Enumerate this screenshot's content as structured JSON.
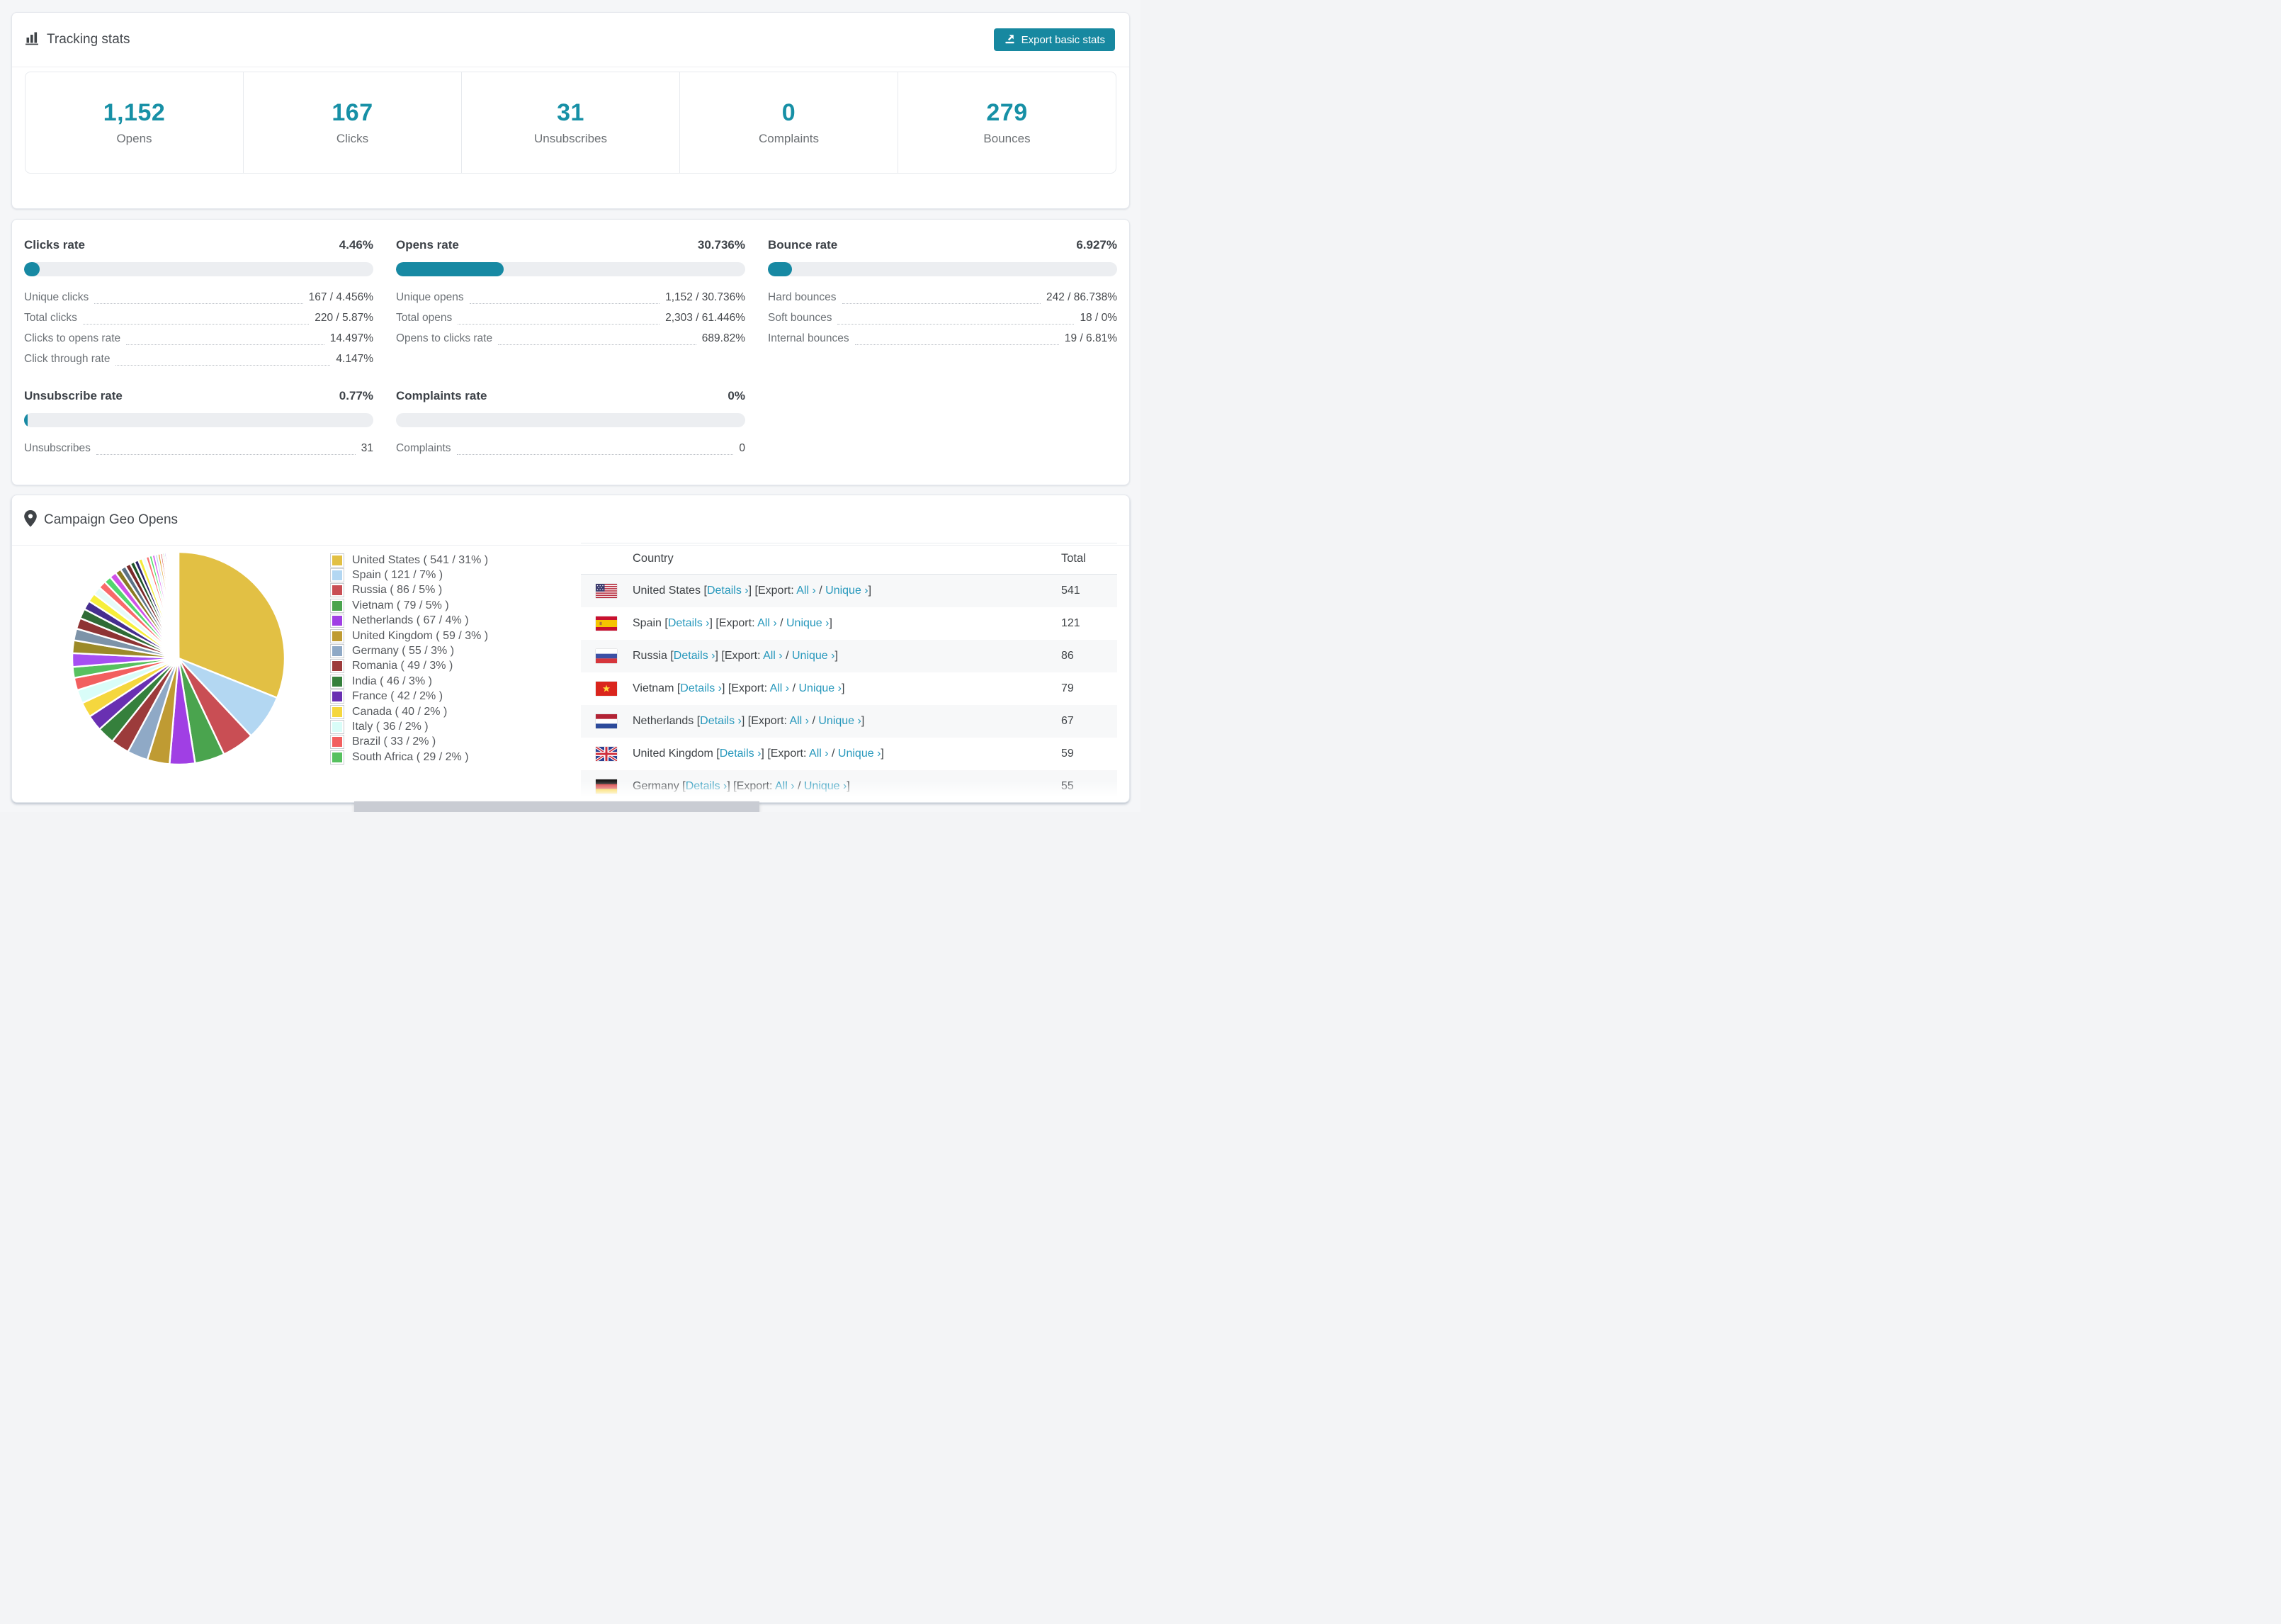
{
  "tracking_card": {
    "title": "Tracking stats",
    "export_button": {
      "label": "Export basic stats"
    },
    "stats": [
      {
        "value": "1,152",
        "label": "Opens"
      },
      {
        "value": "167",
        "label": "Clicks"
      },
      {
        "value": "31",
        "label": "Unsubscribes"
      },
      {
        "value": "0",
        "label": "Complaints"
      },
      {
        "value": "279",
        "label": "Bounces"
      }
    ]
  },
  "rates_card": {
    "sections": [
      {
        "title": "Clicks rate",
        "value": "4.46%",
        "percent": 4.46,
        "rows": [
          {
            "label": "Unique clicks",
            "value": "167 / 4.456%"
          },
          {
            "label": "Total clicks",
            "value": "220 / 5.87%"
          },
          {
            "label": "Clicks to opens rate",
            "value": "14.497%"
          },
          {
            "label": "Click through rate",
            "value": "4.147%"
          }
        ]
      },
      {
        "title": "Opens rate",
        "value": "30.736%",
        "percent": 30.736,
        "rows": [
          {
            "label": "Unique opens",
            "value": "1,152 / 30.736%"
          },
          {
            "label": "Total opens",
            "value": "2,303 / 61.446%"
          },
          {
            "label": "Opens to clicks rate",
            "value": "689.82%"
          }
        ]
      },
      {
        "title": "Bounce rate",
        "value": "6.927%",
        "percent": 6.927,
        "rows": [
          {
            "label": "Hard bounces",
            "value": "242 / 86.738%"
          },
          {
            "label": "Soft bounces",
            "value": "18 / 0%"
          },
          {
            "label": "Internal bounces",
            "value": "19 / 6.81%"
          }
        ]
      },
      {
        "title": "Unsubscribe rate",
        "value": "0.77%",
        "percent": 0.77,
        "rows": [
          {
            "label": "Unsubscribes",
            "value": "31"
          }
        ]
      },
      {
        "title": "Complaints rate",
        "value": "0%",
        "percent": 0,
        "rows": [
          {
            "label": "Complaints",
            "value": "0"
          }
        ]
      }
    ]
  },
  "geo_card": {
    "title": "Campaign Geo Opens",
    "chart_data": {
      "type": "pie",
      "title": "Campaign Geo Opens",
      "legend_position": "right",
      "series": [
        {
          "name": "United States",
          "count": 541,
          "pct": "31%",
          "color": "#e2c044",
          "flag": "us"
        },
        {
          "name": "Spain",
          "count": 121,
          "pct": "7%",
          "color": "#b3d7f2",
          "flag": "es"
        },
        {
          "name": "Russia",
          "count": 86,
          "pct": "5%",
          "color": "#c94e54",
          "flag": "ru"
        },
        {
          "name": "Vietnam",
          "count": 79,
          "pct": "5%",
          "color": "#4aa44e",
          "flag": "vn"
        },
        {
          "name": "Netherlands",
          "count": 67,
          "pct": "4%",
          "color": "#a03fe4",
          "flag": "nl"
        },
        {
          "name": "United Kingdom",
          "count": 59,
          "pct": "3%",
          "color": "#bf9b33",
          "flag": "gb"
        },
        {
          "name": "Germany",
          "count": 55,
          "pct": "3%",
          "color": "#8fa9c6",
          "flag": "de"
        },
        {
          "name": "Romania",
          "count": 49,
          "pct": "3%",
          "color": "#9c3b3b"
        },
        {
          "name": "India",
          "count": 46,
          "pct": "3%",
          "color": "#35803c"
        },
        {
          "name": "France",
          "count": 42,
          "pct": "2%",
          "color": "#6930b2"
        },
        {
          "name": "Canada",
          "count": 40,
          "pct": "2%",
          "color": "#f5d73e"
        },
        {
          "name": "Italy",
          "count": 36,
          "pct": "2%",
          "color": "#d9fdf8"
        },
        {
          "name": "Brazil",
          "count": 33,
          "pct": "2%",
          "color": "#f25f5f"
        },
        {
          "name": "South Africa",
          "count": 29,
          "pct": "2%",
          "color": "#57c15f"
        }
      ],
      "other_slices": [
        {
          "v": 36,
          "c": "#a64ff2"
        },
        {
          "v": 34,
          "c": "#9c8a28"
        },
        {
          "v": 31,
          "c": "#7d93a8"
        },
        {
          "v": 29,
          "c": "#8e3434"
        },
        {
          "v": 26,
          "c": "#2f6b36"
        },
        {
          "v": 24,
          "c": "#452d8f"
        },
        {
          "v": 23,
          "c": "#f7ef3a"
        },
        {
          "v": 22,
          "c": "#e7fbf8"
        },
        {
          "v": 20,
          "c": "#f96a6a"
        },
        {
          "v": 19,
          "c": "#52d66e"
        },
        {
          "v": 18,
          "c": "#cf52e8"
        },
        {
          "v": 16,
          "c": "#8a7a22"
        },
        {
          "v": 15,
          "c": "#5b7285"
        },
        {
          "v": 14,
          "c": "#7a2a2a"
        },
        {
          "v": 12,
          "c": "#1e5427"
        },
        {
          "v": 11,
          "c": "#2c2368"
        },
        {
          "v": 11,
          "c": "#f4ea3d"
        },
        {
          "v": 10,
          "c": "#ecfffd"
        },
        {
          "v": 9,
          "c": "#fa7070"
        },
        {
          "v": 8,
          "c": "#4ee06c"
        },
        {
          "v": 8,
          "c": "#d863ef"
        },
        {
          "v": 7,
          "c": "#b9d9f0"
        },
        {
          "v": 7,
          "c": "#e0a030"
        },
        {
          "v": 6,
          "c": "#d94a4a"
        },
        {
          "v": 5,
          "c": "#3faf4f"
        },
        {
          "v": 5,
          "c": "#8a52f0"
        },
        {
          "v": 4,
          "c": "#c3a032"
        },
        {
          "v": 4,
          "c": "#6b8092"
        },
        {
          "v": 4,
          "c": "#a03b3b"
        },
        {
          "v": 3,
          "c": "#2f6b36"
        },
        {
          "v": 3,
          "c": "#6930b2"
        },
        {
          "v": 3,
          "c": "#f5d73e"
        },
        {
          "v": 2,
          "c": "#d9fdf8"
        },
        {
          "v": 2,
          "c": "#f25f5f"
        },
        {
          "v": 2,
          "c": "#57c15f"
        },
        {
          "v": 1,
          "c": "#a64ff2"
        },
        {
          "v": 1,
          "c": "#9c8a28"
        },
        {
          "v": 1,
          "c": "#7d93a8"
        },
        {
          "v": 1,
          "c": "#8e3434"
        },
        {
          "v": 1,
          "c": "#2f6b36"
        }
      ]
    },
    "legend_format": {
      "open": " ( ",
      "sep": " / ",
      "close": " )"
    },
    "table": {
      "columns": [
        "Country",
        "Total"
      ],
      "links": {
        "bracket_open": " [",
        "details": "Details ›",
        "export_prefix": "] [Export: ",
        "all": "All ›",
        "slash": " / ",
        "unique": "Unique ›",
        "bracket_close": "]"
      },
      "rows": [
        {
          "country": "United States",
          "flag": "us",
          "total": "541"
        },
        {
          "country": "Spain",
          "flag": "es",
          "total": "121"
        },
        {
          "country": "Russia",
          "flag": "ru",
          "total": "86"
        },
        {
          "country": "Vietnam",
          "flag": "vn",
          "total": "79"
        },
        {
          "country": "Netherlands",
          "flag": "nl",
          "total": "67"
        },
        {
          "country": "United Kingdom",
          "flag": "gb",
          "total": "59"
        },
        {
          "country": "Germany",
          "flag": "de",
          "total": "55"
        }
      ]
    }
  },
  "colors": {
    "accent": "#1789a3",
    "button": "#1788a0",
    "stat_number": "#1790a6",
    "link": "#2798bc",
    "bar_track": "#eceef1",
    "zebra_row": "#f7f8f9"
  }
}
